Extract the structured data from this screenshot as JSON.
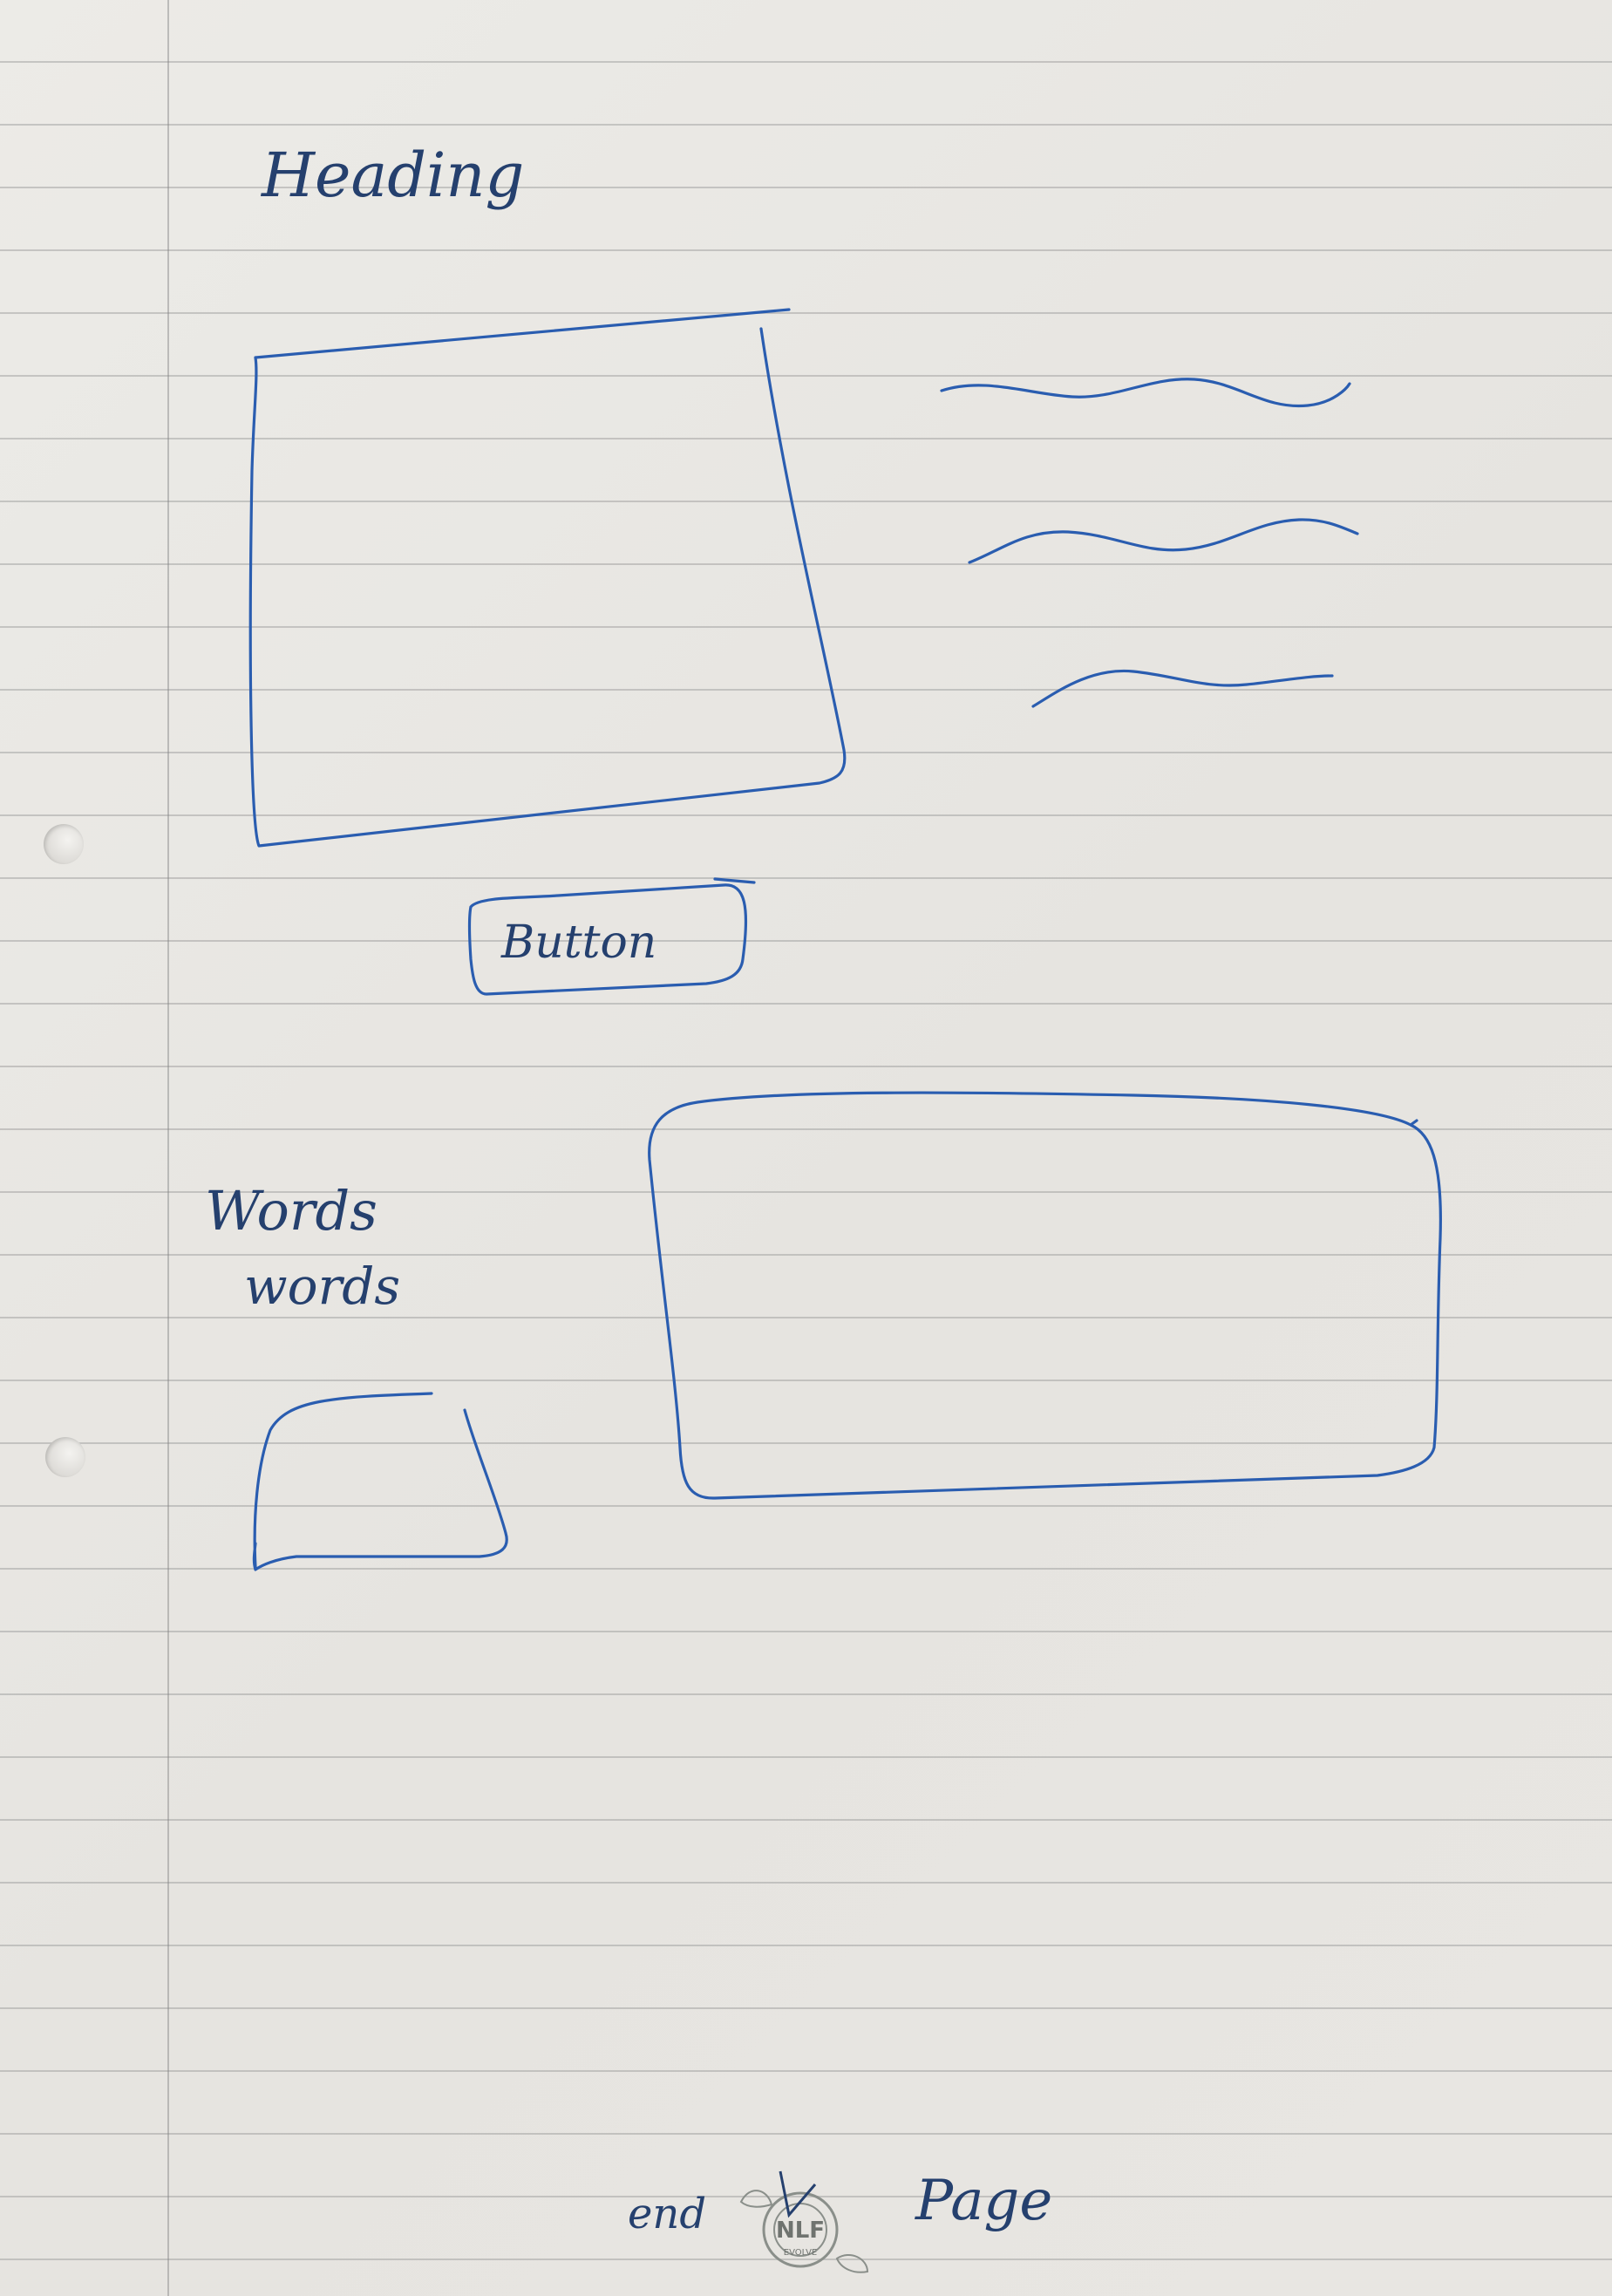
{
  "heading": "Heading",
  "button_label": "Button",
  "words": [
    "Words",
    "words"
  ],
  "footer": {
    "end_text": "end",
    "page_text": "Page",
    "stamp_text": "NLF",
    "stamp_subtext": "EVOLVE"
  },
  "colors": {
    "ink": "#25406e",
    "sketch_ink": "#2a5db0",
    "paper": "#e9e7e3"
  }
}
